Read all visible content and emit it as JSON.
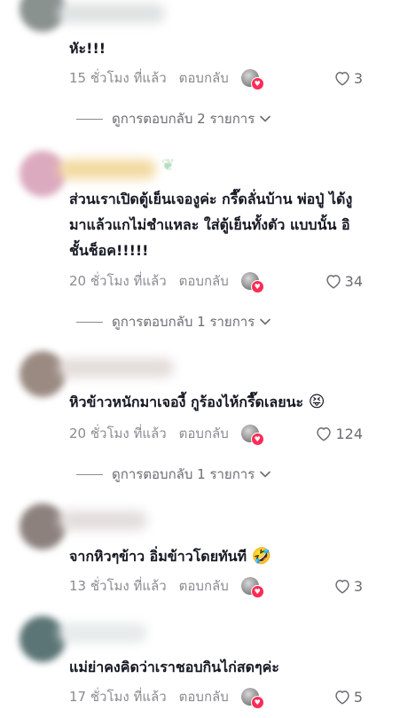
{
  "comments": [
    {
      "text": "หัะ!!!",
      "time": "15 ชั่วโมง ที่แล้ว",
      "reply_label": "ตอบกลับ",
      "likes": "3",
      "view_replies": "ดูการตอบกลับ 2 รายการ"
    },
    {
      "text": "ส่วนเราเปิดตู้เย็นเจองูค่ะ กรี๊ดลั่นบ้าน พ่อปู่ ได้งูมาแล้วแกไม่ชำแหละ ใส่ตู้เย็นทั้งตัว แบบนั้น อิชั้นช็อค!!!!!",
      "time": "20 ชั่วโมง ที่แล้ว",
      "reply_label": "ตอบกลับ",
      "likes": "34",
      "view_replies": "ดูการตอบกลับ 1 รายการ"
    },
    {
      "text": "หิวข้าวหนักมาเจองี้ กูร้องไห้กรี๊ดเลยนะ",
      "emoji": "😝",
      "time": "20 ชั่วโมง ที่แล้ว",
      "reply_label": "ตอบกลับ",
      "likes": "124",
      "view_replies": "ดูการตอบกลับ 1 รายการ"
    },
    {
      "text": "จากหิวๆข้าว อิ่มข้าวโดยทันที",
      "emoji": "🤣",
      "time": "13 ชั่วโมง ที่แล้ว",
      "reply_label": "ตอบกลับ",
      "likes": "3"
    },
    {
      "text": "แม่ย่าคงคิดว่าเราชอบกินไก่สดๆค่ะ",
      "time": "17 ชั่วโมง ที่แล้ว",
      "reply_label": "ตอบกลับ",
      "likes": "5"
    }
  ],
  "icons": {
    "like": "heart-outline-icon",
    "expand": "chevron-down-icon",
    "creator_badge": "heart-badge-icon"
  },
  "colors": {
    "text": "#161823",
    "secondary": "#8a8b91",
    "badge": "#fe2c55"
  }
}
